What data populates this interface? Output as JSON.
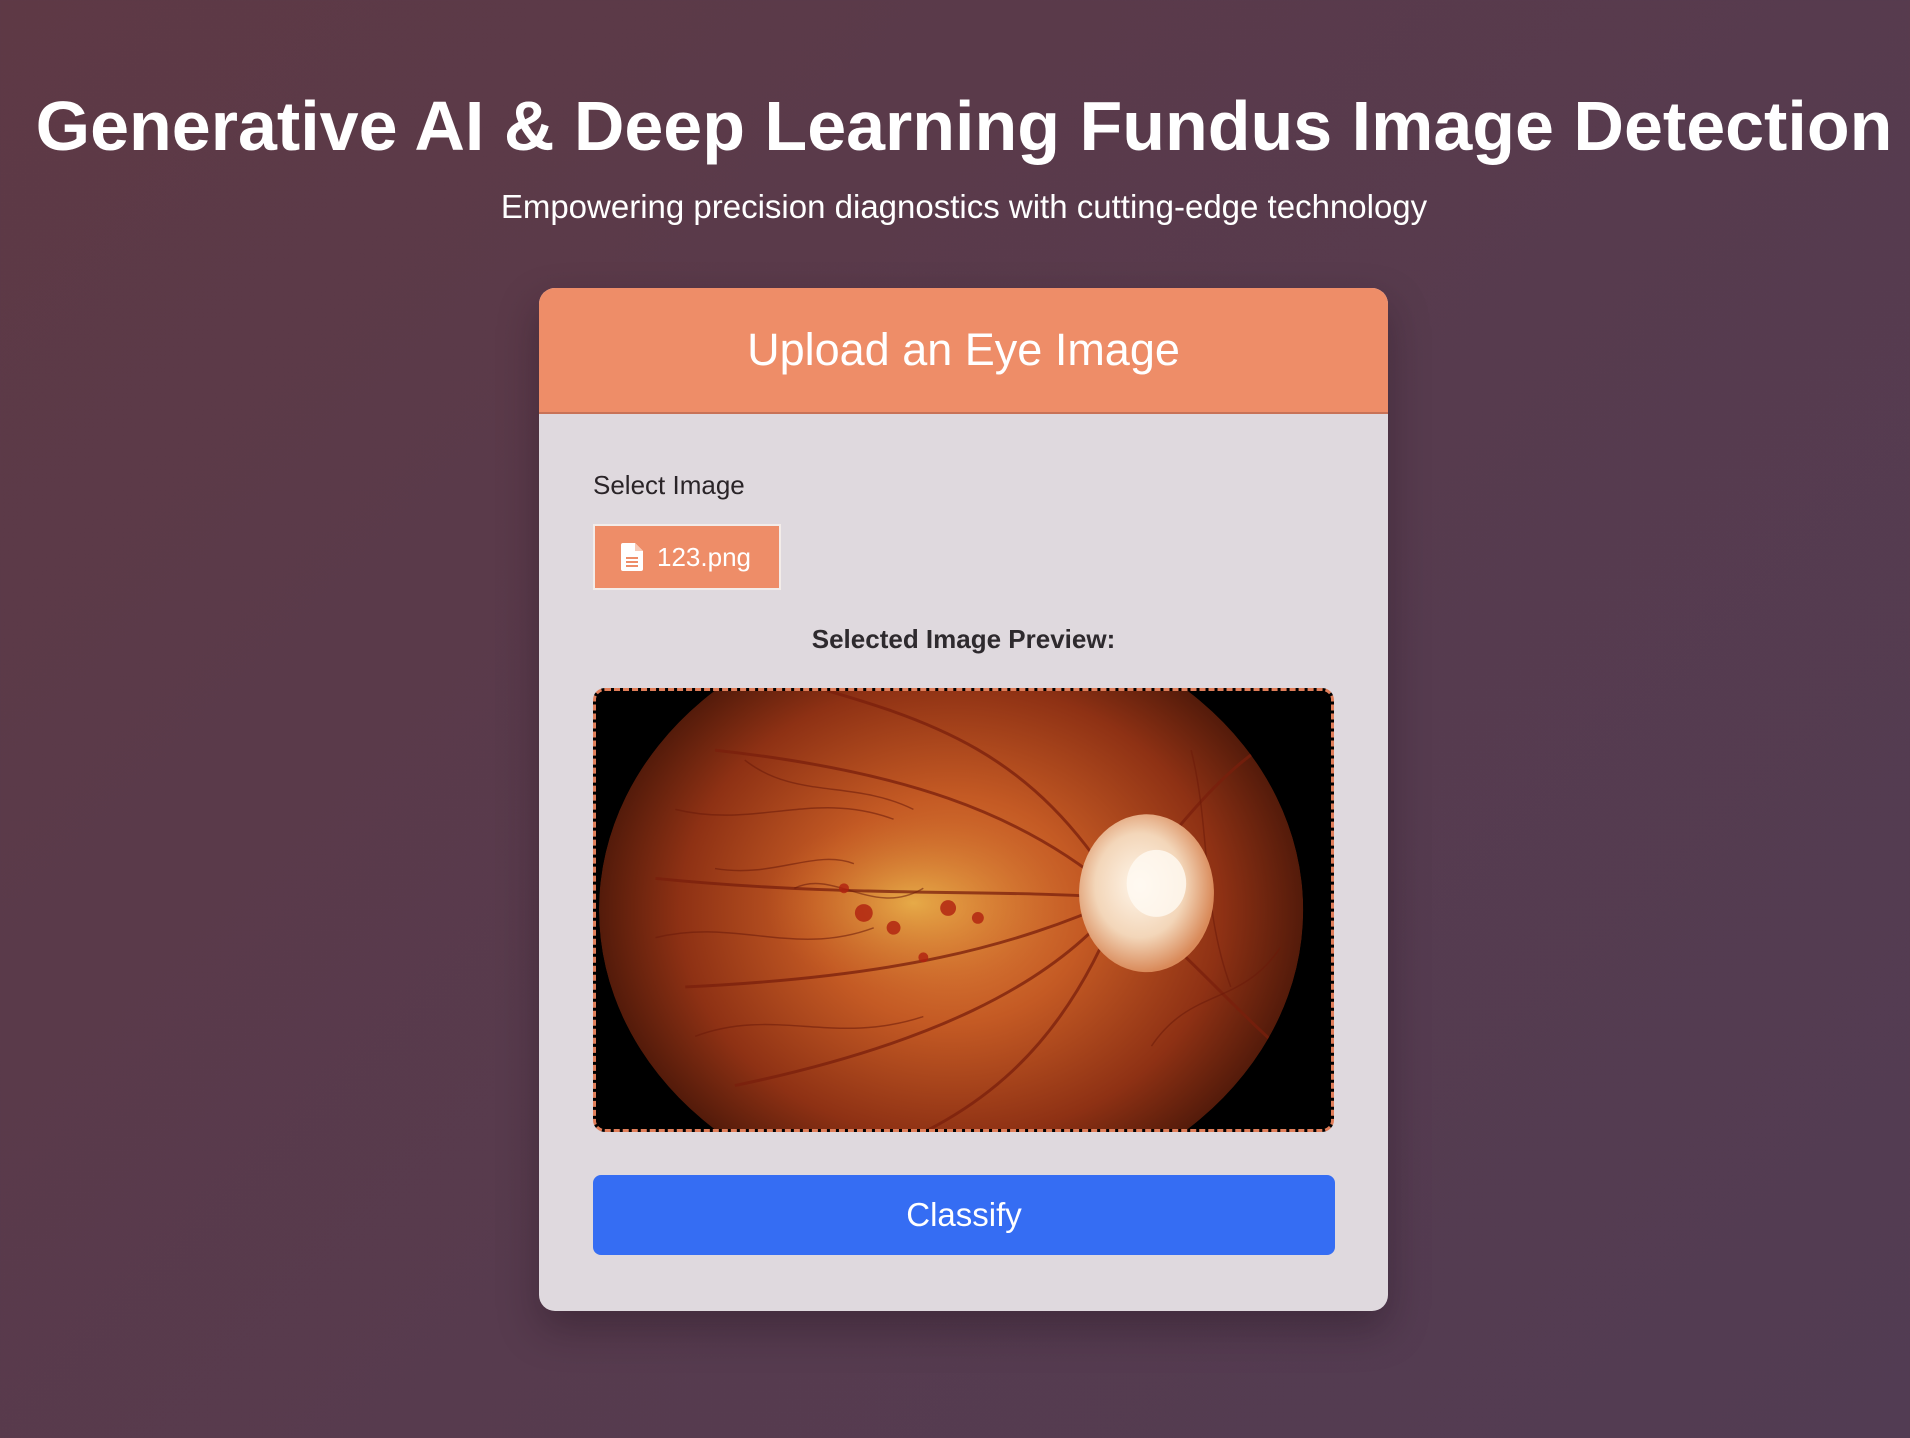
{
  "hero": {
    "title": "Generative AI & Deep Learning Fundus Image Detection",
    "subtitle": "Empowering precision diagnostics with cutting-edge technology"
  },
  "card": {
    "header_title": "Upload an Eye Image",
    "select_label": "Select Image",
    "file_name": "123.png",
    "file_icon": "file-icon",
    "preview_label": "Selected Image Preview:",
    "classify_label": "Classify"
  },
  "colors": {
    "background": "#573b4e",
    "card_background": "#dfd9de",
    "accent_orange": "#ee8d68",
    "primary_blue": "#356df3"
  }
}
